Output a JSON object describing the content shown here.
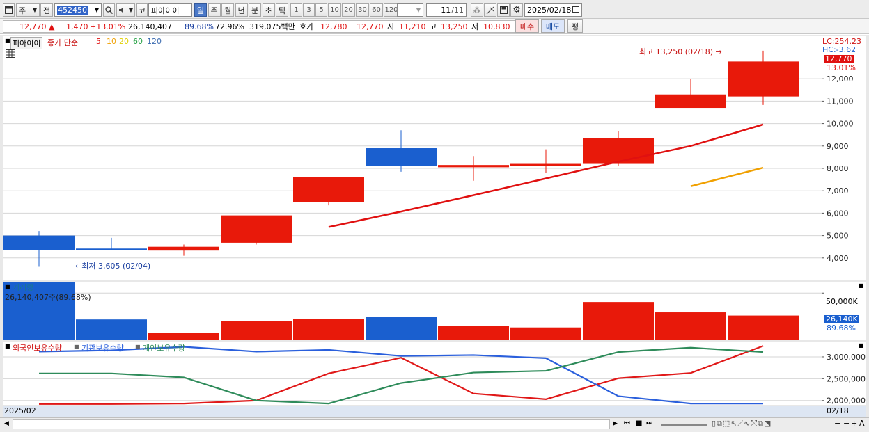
{
  "toolbar": {
    "market_btn": "주",
    "prev_btn": "전",
    "code": "452450",
    "type_btn": "코",
    "name": "피아이이",
    "periods": [
      "일",
      "주",
      "월",
      "년",
      "분",
      "초",
      "틱"
    ],
    "selected_period": "일",
    "numbers": [
      "1",
      "3",
      "5",
      "10",
      "20",
      "30",
      "60",
      "120"
    ],
    "count": "11",
    "count_total": "/11",
    "date": "2025/02/18"
  },
  "quote": {
    "price": "12,770",
    "arrow": "▲",
    "change": "1,470",
    "change_pct": "+13.01%",
    "volume": "26,140,407",
    "rate1": "89.68%",
    "rate2": "72.96%",
    "amount": "319,075백만",
    "bid_label": "호가",
    "bid1": "12,780",
    "bid2": "12,770",
    "open_label": "시",
    "open": "11,210",
    "high_label": "고",
    "high": "13,250",
    "low_label": "저",
    "low": "10,830",
    "buy_btn": "매수",
    "sell_btn": "매도",
    "eval_btn": "평"
  },
  "price_panel": {
    "name_tag": "피아이이",
    "legend_prefix": "종가 단순",
    "ma_labels": [
      "5",
      "10",
      "20",
      "60",
      "120"
    ],
    "ma_colors": [
      "#e01010",
      "#f0a000",
      "#e0d000",
      "#20a040",
      "#3a6ab0"
    ],
    "lc": "LC:254.23",
    "hc": "HC:-3.62",
    "last_price": "12,770",
    "last_pct": "13.01%",
    "max_note": "최고 13,250 (02/18)",
    "min_note": "최저 3,605 (02/04)"
  },
  "volume_panel": {
    "title": "거래량",
    "info": "26,140,407주(89.68%)",
    "last": "26,140K",
    "last_pct": "89.68%",
    "tick": "50,000K"
  },
  "holdings_panel": {
    "legend": [
      "외국인보유수량",
      "기관보유수량",
      "개인보유수량"
    ]
  },
  "footer": {
    "start": "2025/02",
    "end": "02/18"
  },
  "chart_data": [
    {
      "type": "candlestick",
      "up_color": "#e8190a",
      "down_color": "#1a5fcf",
      "ylim": [
        3000,
        13900
      ],
      "yticks": [
        4000,
        5000,
        6000,
        7000,
        8000,
        9000,
        10000,
        11000,
        12000
      ],
      "candles": [
        {
          "o": 5000,
          "h": 5200,
          "l": 3605,
          "c": 4350
        },
        {
          "o": 4420,
          "h": 4900,
          "l": 4350,
          "c": 4380
        },
        {
          "o": 4330,
          "h": 4600,
          "l": 4100,
          "c": 4500
        },
        {
          "o": 4680,
          "h": 4750,
          "l": 4600,
          "c": 5900
        },
        {
          "o": 6500,
          "h": 7600,
          "l": 6350,
          "c": 7600
        },
        {
          "o": 8900,
          "h": 9700,
          "l": 7850,
          "c": 8100
        },
        {
          "o": 8050,
          "h": 8550,
          "l": 7450,
          "c": 8150
        },
        {
          "o": 8100,
          "h": 8850,
          "l": 7800,
          "c": 8200
        },
        {
          "o": 8200,
          "h": 9650,
          "l": 8100,
          "c": 9350
        },
        {
          "o": 10700,
          "h": 12000,
          "l": 10700,
          "c": 11300
        },
        {
          "o": 11210,
          "h": 13250,
          "l": 10830,
          "c": 12770
        }
      ],
      "ma5": [
        null,
        null,
        null,
        null,
        5380,
        6070,
        6800,
        7550,
        8300,
        9000,
        9960
      ],
      "ma10": [
        null,
        null,
        null,
        null,
        null,
        null,
        null,
        null,
        null,
        7200,
        8030
      ]
    },
    {
      "type": "bar",
      "ylim": [
        0,
        62000
      ],
      "yticks": [
        50000
      ],
      "values": [
        64000,
        22000,
        7500,
        20000,
        22500,
        25000,
        15000,
        13500,
        40500,
        29500,
        26140
      ],
      "colors": [
        "down",
        "down",
        "up",
        "up",
        "up",
        "down",
        "up",
        "up",
        "up",
        "up",
        "up"
      ]
    },
    {
      "type": "line",
      "ylim": [
        1900000,
        3350000
      ],
      "yticks": [
        2000000,
        2500000,
        3000000
      ],
      "series": [
        {
          "name": "외국인보유수량",
          "color": "#e01818",
          "values": [
            1920000,
            1920000,
            1930000,
            2000000,
            2620000,
            2980000,
            2160000,
            2030000,
            2510000,
            2630000,
            3250000
          ]
        },
        {
          "name": "기관보유수량",
          "color": "#2a5fdc",
          "values": [
            3120000,
            3150000,
            3230000,
            3120000,
            3160000,
            3020000,
            3040000,
            2970000,
            2100000,
            1930000,
            1930000
          ]
        },
        {
          "name": "개인보유수량",
          "color": "#2e8b5a",
          "values": [
            2620000,
            2620000,
            2530000,
            2000000,
            1930000,
            2400000,
            2640000,
            2680000,
            3110000,
            3210000,
            3110000
          ]
        }
      ]
    }
  ]
}
